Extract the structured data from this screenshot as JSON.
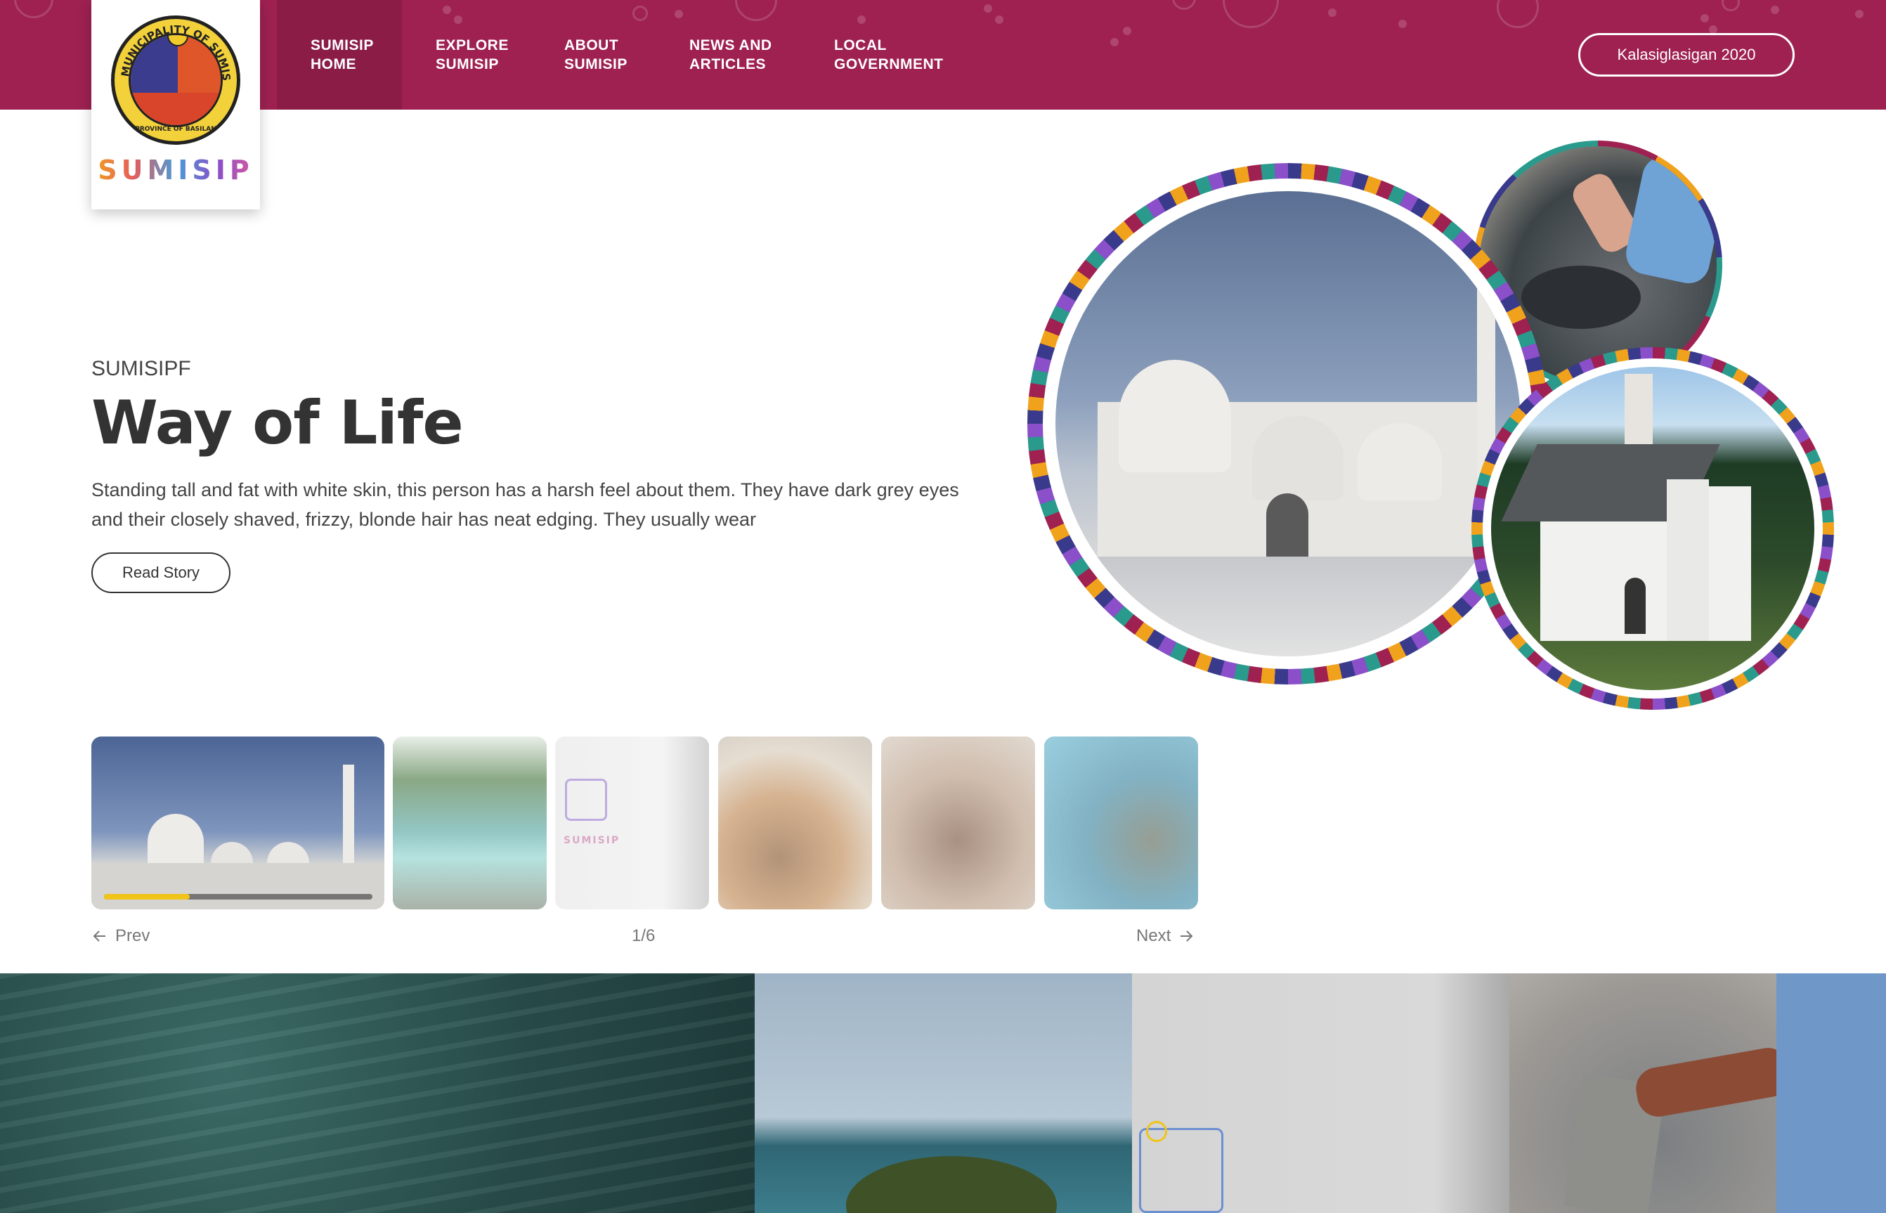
{
  "header": {
    "logo": {
      "ring_text": "MUNICIPALITY OF SUMISIP",
      "province_text": "PROVINCE OF BASILAN",
      "wordmark": "SUMISIP"
    },
    "nav": [
      {
        "line1": "SUMISIP",
        "line2": "HOME",
        "active": true
      },
      {
        "line1": "EXPLORE",
        "line2": "SUMISIP",
        "active": false
      },
      {
        "line1": "ABOUT",
        "line2": "SUMISIP",
        "active": false
      },
      {
        "line1": "NEWS AND",
        "line2": "ARTICLES",
        "active": false
      },
      {
        "line1": "LOCAL",
        "line2": "GOVERNMENT",
        "active": false
      }
    ],
    "cta_label": "Kalasiglasigan 2020"
  },
  "hero": {
    "eyebrow": "SUMISIPF",
    "title": "Way of Life",
    "description": "Standing tall and fat with white skin, this person has a harsh feel about them. They have dark grey eyes and their closely shaved, frizzy, blonde hair has neat edging. They usually wear",
    "button_label": "Read Story"
  },
  "circles": [
    {
      "name": "mosque-photo"
    },
    {
      "name": "fish-market-photo"
    },
    {
      "name": "church-photo"
    }
  ],
  "thumbnails": [
    {
      "name": "mosque",
      "progress": 0.32
    },
    {
      "name": "river"
    },
    {
      "name": "sumisip-wall"
    },
    {
      "name": "food"
    },
    {
      "name": "market-vendor"
    },
    {
      "name": "coral-reef"
    }
  ],
  "pager": {
    "prev": "Prev",
    "count": "1/6",
    "next": "Next"
  },
  "colors": {
    "brand": "#9e2151",
    "accent": "#f0c419",
    "text": "#333333"
  },
  "icons": {
    "prev": "arrow-left-icon",
    "next": "arrow-right-icon"
  }
}
